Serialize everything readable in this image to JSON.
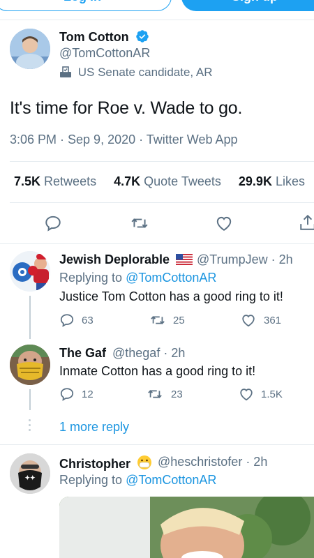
{
  "top_buttons": {
    "login": "Log in",
    "signup": "Sign up"
  },
  "main_tweet": {
    "name": "Tom Cotton",
    "handle": "@TomCottonAR",
    "label": "US Senate candidate, AR",
    "text": "It's time for Roe v. Wade to go.",
    "meta": "3:06 PM · Sep 9, 2020 · Twitter Web App",
    "stats": {
      "retweets_count": "7.5K",
      "retweets_label": "Retweets",
      "quotes_count": "4.7K",
      "quotes_label": "Quote Tweets",
      "likes_count": "29.9K",
      "likes_label": "Likes"
    }
  },
  "replies": [
    {
      "name": "Jewish Deplorable",
      "handle_time": "@TrumpJew · 2h",
      "replying_prefix": "Replying to",
      "replying_to": "@TomCottonAR",
      "text": "Justice Tom Cotton has a good ring to it!",
      "replies": "63",
      "retweets": "25",
      "likes": "361"
    },
    {
      "name": "The Gaf",
      "handle_time": "@thegaf · 2h",
      "text": "Inmate Cotton has a good ring to it!",
      "replies": "12",
      "retweets": "23",
      "likes": "1.5K"
    }
  ],
  "more_replies": "1 more reply",
  "reply3": {
    "name": "Christopher",
    "handle_time": "@heschristofer · 2h",
    "replying_prefix": "Replying to",
    "replying_to": "@TomCottonAR"
  },
  "colors": {
    "accent": "#1da1f2",
    "link": "#1b95e0",
    "muted": "#5b7083",
    "border": "#e6ecf0"
  }
}
